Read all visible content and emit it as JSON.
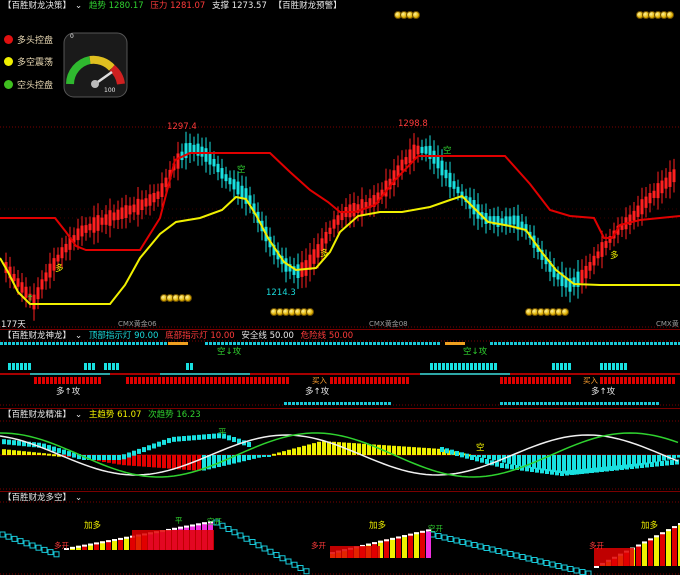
{
  "main": {
    "indicator_name": "【百胜财龙决策】",
    "trend_label": "趋势",
    "trend_value": "1280.17",
    "pressure_label": "压力",
    "pressure_value": "1281.07",
    "support_label": "支撑",
    "support_value": "1273.57",
    "warning_name": "【百胜财龙预警】",
    "legend": [
      {
        "label": "多头控盘",
        "color": "#e01010"
      },
      {
        "label": "多空震荡",
        "color": "#f0f000"
      },
      {
        "label": "空头控盘",
        "color": "#3fbf1f"
      }
    ],
    "gauge_min": "0",
    "gauge_max": "100",
    "high_labels": [
      "1297.4",
      "1298.8"
    ],
    "low_label": "1214.3",
    "kong_label": "空",
    "duo_label": "多",
    "days_label": "177天",
    "contract_labels": [
      "CMX黄金06",
      "CMX黄金08",
      "CMX黄"
    ]
  },
  "shenlong": {
    "indicator_name": "【百胜财龙神龙】",
    "top_label": "顶部指示灯",
    "top_value": "90.00",
    "bottom_label": "底部指示灯",
    "bottom_value": "10.00",
    "safe_label": "安全线",
    "safe_value": "50.00",
    "danger_label": "危险线",
    "danger_value": "50.00",
    "kong_gong": [
      "空↓攻",
      "空↓攻"
    ],
    "duo_gong": [
      "多↑攻",
      "多↑攻",
      "多↑攻"
    ],
    "buy_labels": [
      "买入",
      "买入"
    ]
  },
  "jingzhun": {
    "indicator_name": "【百胜财龙精准】",
    "main_label": "主趋势",
    "main_value": "61.07",
    "sub_label": "次趋势",
    "sub_value": "16.23",
    "marks": [
      "平",
      "空"
    ]
  },
  "duokong": {
    "indicator_name": "【百胜财龙多空】",
    "jia_duo": [
      "加多",
      "加多",
      "加多"
    ],
    "duo_kai": [
      "多开",
      "多开",
      "多开"
    ],
    "kong_kai": [
      "空开",
      "空开"
    ],
    "ping": "平"
  },
  "chart_data": {
    "type": "candlestick",
    "high_marks": [
      1297.4,
      1298.8
    ],
    "low_marks": [
      1214.3
    ],
    "trend": 1280.17,
    "pressure": 1281.07,
    "support": 1273.57,
    "top_indicator": 90.0,
    "bottom_indicator": 10.0,
    "safe_line": 50.0,
    "danger_line": 50.0,
    "main_trend": 61.07,
    "sub_trend": 16.23,
    "gauge_range": [
      0,
      100
    ]
  }
}
